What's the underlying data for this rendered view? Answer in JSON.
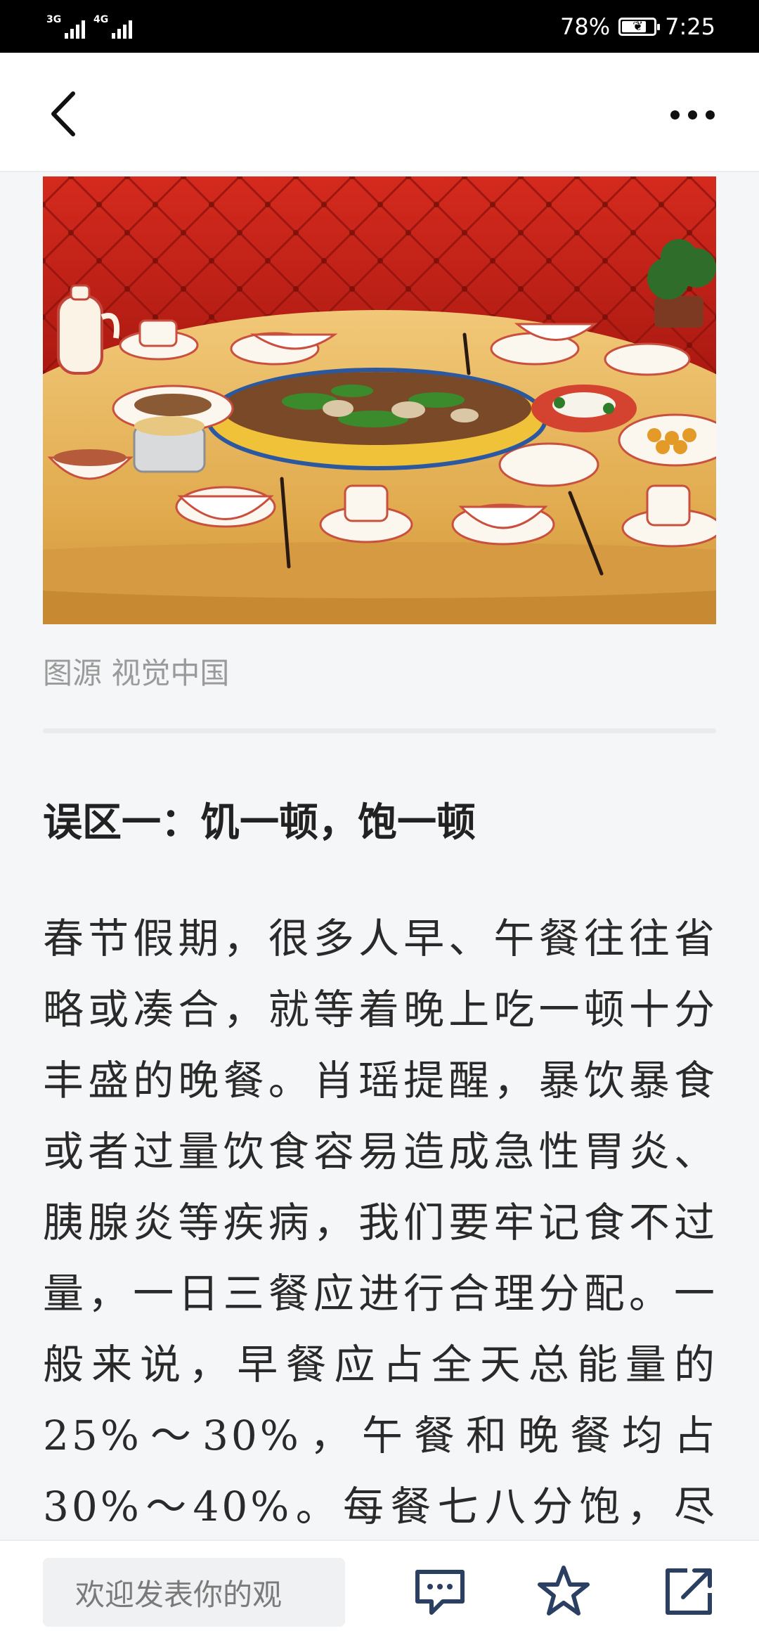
{
  "status_bar": {
    "signal_1_tag": "3G",
    "signal_2_tag": "4G",
    "battery_percent": "78%",
    "battery_level": 0.78,
    "time": "7:25"
  },
  "nav": {
    "back_icon": "chevron-left-icon",
    "more_icon": "more-horizontal-icon"
  },
  "article": {
    "image_caption": "图源 视觉中国",
    "section_title": "误区一：饥一顿，饱一顿",
    "body": "春节假期，很多人早、午餐往往省略或凑合，就等着晚上吃一顿十分丰盛的晚餐。肖瑶提醒，暴饮暴食或者过量饮食容易造成急性胃炎、胰腺炎等疾病，我们要牢记食不过量，一日三餐应进行合理分配。一般来说，早餐应占全天总能量的25%～30%，午餐和晚餐均占30%～40%。每餐七八分饱，尽量抵挡"
  },
  "bottom_bar": {
    "comment_placeholder": "欢迎发表你的观",
    "comment_icon": "comment-icon",
    "favorite_icon": "star-icon",
    "share_icon": "share-icon"
  },
  "colors": {
    "status_bar_bg": "#000000",
    "page_bg": "#f5f6f8",
    "caption_gray": "#9a9a9a",
    "tablecloth_gold": "#e2b25a",
    "wall_red": "#c8251c"
  }
}
